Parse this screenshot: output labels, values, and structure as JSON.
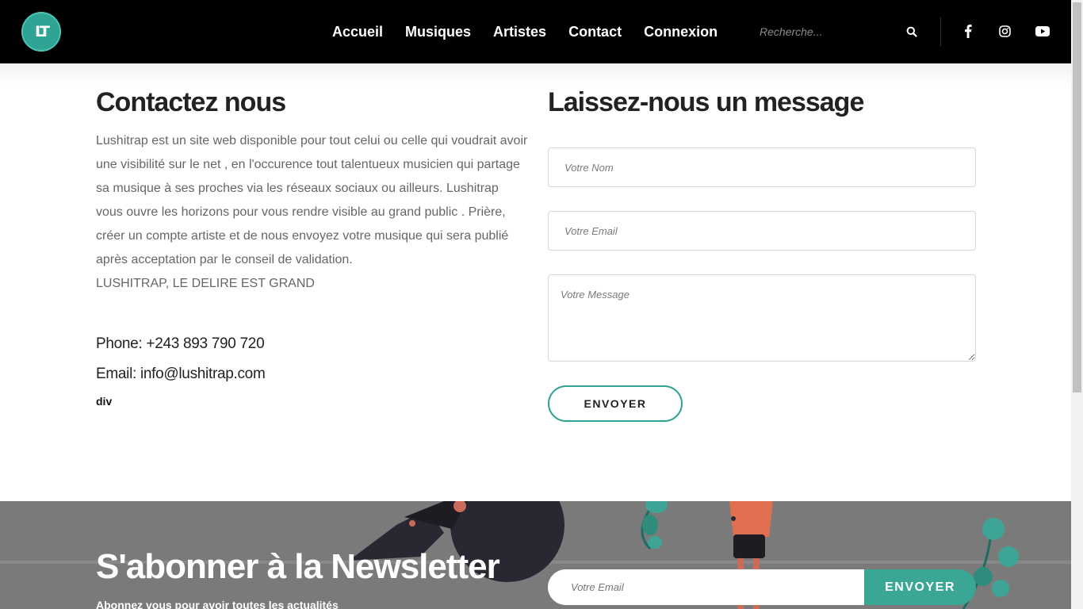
{
  "header": {
    "logo_text": "LT",
    "nav": [
      "Accueil",
      "Musiques",
      "Artistes",
      "Contact",
      "Connexion"
    ],
    "search_placeholder": "Recherche...",
    "social_icons": [
      "facebook-icon",
      "instagram-icon",
      "youtube-icon"
    ]
  },
  "contact": {
    "title": "Contactez nous",
    "paragraphs": [
      "Lushitrap est un site web disponible pour tout celui ou celle qui voudrait avoir une visibilité sur le net , en l'occurence tout talentueux musicien qui partage sa musique à ses proches via les réseaux sociaux ou ailleurs. Lushitrap vous ouvre les horizons pour vous rendre visible au grand public . Prière, créer un compte artiste et de nous envoyez votre musique qui sera publié après acceptation par le conseil de validation.",
      "LUSHITRAP, LE DELIRE EST GRAND"
    ],
    "phone": "Phone: +243 893 790 720",
    "email": "Email: info@lushitrap.com",
    "stray_label": "div"
  },
  "message_form": {
    "title": "Laissez-nous un message",
    "name_placeholder": "Votre Nom",
    "email_placeholder": "Votre Email",
    "message_placeholder": "Votre Message",
    "submit_label": "ENVOYER"
  },
  "newsletter": {
    "title": "S'abonner à la Newsletter",
    "subtitle": "Abonnez vous pour avoir toutes les actualités",
    "email_placeholder": "Votre Email",
    "submit_label": "ENVOYER"
  },
  "colors": {
    "accent": "#2fa394",
    "header_bg": "#000000",
    "newsletter_bg": "#7a7a7a"
  }
}
